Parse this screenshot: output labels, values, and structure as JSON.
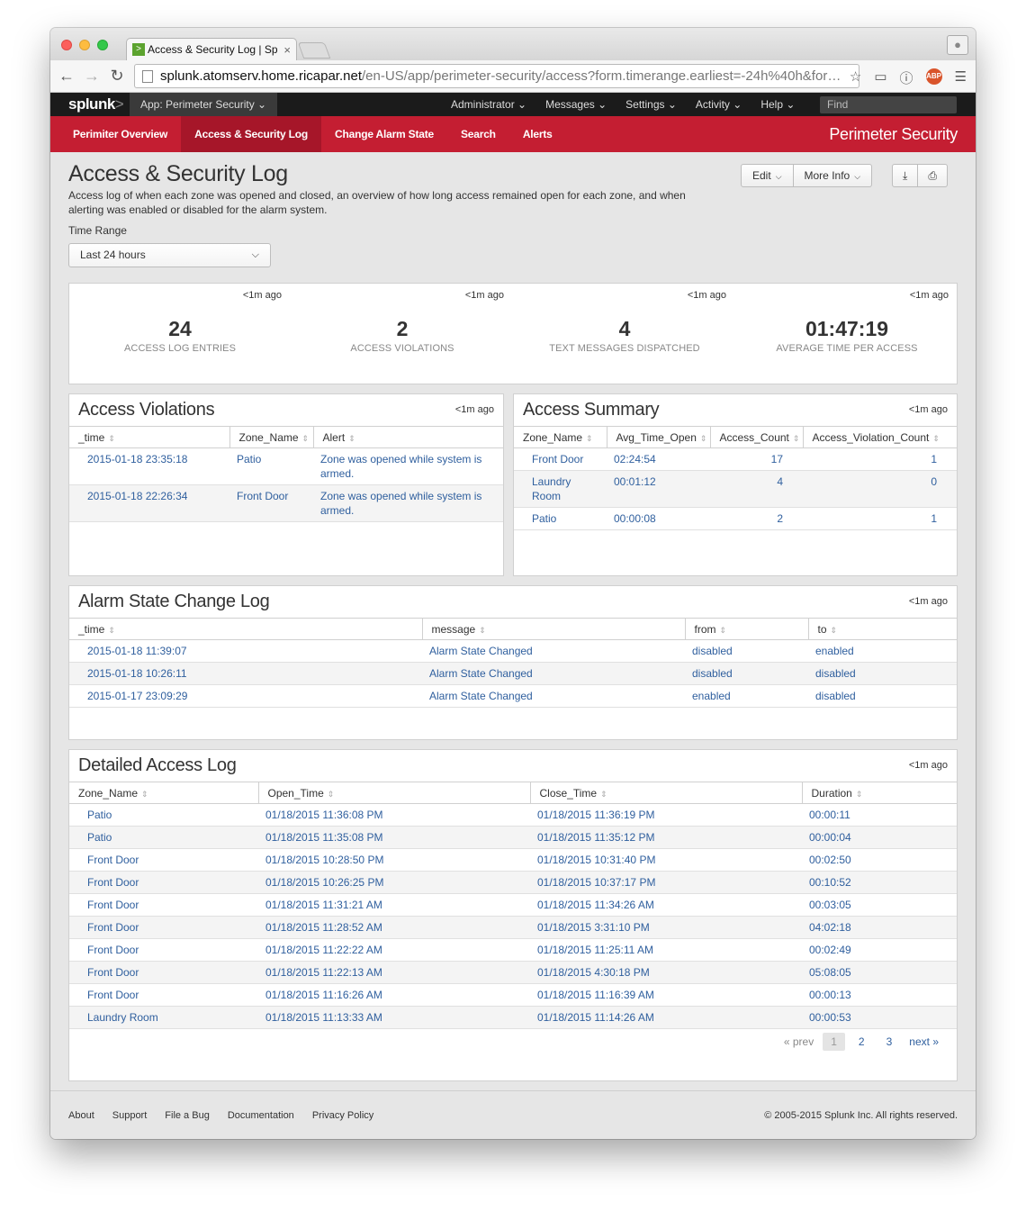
{
  "browser": {
    "tab_title": "Access & Security Log | Sp",
    "tab_close": "×",
    "url_host": "splunk.atomserv.home.ricapar.net",
    "url_path": "/en-US/app/perimeter-security/access?form.timerange.earliest=-24h%40h&for…",
    "back_glyph": "←",
    "forward_glyph": "→",
    "reload_glyph": "↻",
    "abp_label": "ABP"
  },
  "splunkbar": {
    "logo": "splunk",
    "logo_mark": ">",
    "app_menu": "App: Perimeter Security ⌄",
    "menus": [
      "Administrator ⌄",
      "Messages ⌄",
      "Settings ⌄",
      "Activity ⌄",
      "Help ⌄"
    ],
    "find_placeholder": "Find"
  },
  "appnav": {
    "items": [
      "Perimiter Overview",
      "Access & Security Log",
      "Change Alarm State",
      "Search",
      "Alerts"
    ],
    "app_title": "Perimeter Security"
  },
  "page": {
    "title": "Access & Security Log",
    "description": "Access log of when each zone was opened and closed, an overview of how long access remained open for each zone, and when alerting was enabled or disabled for the alarm system.",
    "edit_label": "Edit",
    "more_info_label": "More Info",
    "time_range_label": "Time Range",
    "time_range_value": "Last 24 hours"
  },
  "single_values": [
    {
      "refresh": "<1m ago",
      "value": "24",
      "label": "ACCESS LOG ENTRIES"
    },
    {
      "refresh": "<1m ago",
      "value": "2",
      "label": "ACCESS VIOLATIONS"
    },
    {
      "refresh": "<1m ago",
      "value": "4",
      "label": "TEXT MESSAGES DISPATCHED"
    },
    {
      "refresh": "<1m ago",
      "value": "01:47:19",
      "label": "AVERAGE TIME PER ACCESS"
    }
  ],
  "access_violations": {
    "title": "Access Violations",
    "refresh": "<1m ago",
    "columns": [
      "_time",
      "Zone_Name",
      "Alert"
    ],
    "rows": [
      [
        "2015-01-18 23:35:18",
        "Patio",
        "Zone was opened while system is armed."
      ],
      [
        "2015-01-18 22:26:34",
        "Front Door",
        "Zone was opened while system is armed."
      ]
    ]
  },
  "access_summary": {
    "title": "Access Summary",
    "refresh": "<1m ago",
    "columns": [
      "Zone_Name",
      "Avg_Time_Open",
      "Access_Count",
      "Access_Violation_Count"
    ],
    "rows": [
      [
        "Front Door",
        "02:24:54",
        "17",
        "1"
      ],
      [
        "Laundry Room",
        "00:01:12",
        "4",
        "0"
      ],
      [
        "Patio",
        "00:00:08",
        "2",
        "1"
      ]
    ]
  },
  "alarm_log": {
    "title": "Alarm State Change Log",
    "refresh": "<1m ago",
    "columns": [
      "_time",
      "message",
      "from",
      "to"
    ],
    "rows": [
      [
        "2015-01-18 11:39:07",
        "Alarm State Changed",
        "disabled",
        "enabled"
      ],
      [
        "2015-01-18 10:26:11",
        "Alarm State Changed",
        "disabled",
        "disabled"
      ],
      [
        "2015-01-17 23:09:29",
        "Alarm State Changed",
        "enabled",
        "disabled"
      ]
    ]
  },
  "detailed_log": {
    "title": "Detailed Access Log",
    "refresh": "<1m ago",
    "columns": [
      "Zone_Name",
      "Open_Time",
      "Close_Time",
      "Duration"
    ],
    "rows": [
      [
        "Patio",
        "01/18/2015 11:36:08 PM",
        "01/18/2015 11:36:19 PM",
        "00:00:11"
      ],
      [
        "Patio",
        "01/18/2015 11:35:08 PM",
        "01/18/2015 11:35:12 PM",
        "00:00:04"
      ],
      [
        "Front Door",
        "01/18/2015 10:28:50 PM",
        "01/18/2015 10:31:40 PM",
        "00:02:50"
      ],
      [
        "Front Door",
        "01/18/2015 10:26:25 PM",
        "01/18/2015 10:37:17 PM",
        "00:10:52"
      ],
      [
        "Front Door",
        "01/18/2015 11:31:21 AM",
        "01/18/2015 11:34:26 AM",
        "00:03:05"
      ],
      [
        "Front Door",
        "01/18/2015 11:28:52 AM",
        "01/18/2015 3:31:10 PM",
        "04:02:18"
      ],
      [
        "Front Door",
        "01/18/2015 11:22:22 AM",
        "01/18/2015 11:25:11 AM",
        "00:02:49"
      ],
      [
        "Front Door",
        "01/18/2015 11:22:13 AM",
        "01/18/2015 4:30:18 PM",
        "05:08:05"
      ],
      [
        "Front Door",
        "01/18/2015 11:16:26 AM",
        "01/18/2015 11:16:39 AM",
        "00:00:13"
      ],
      [
        "Laundry Room",
        "01/18/2015 11:13:33 AM",
        "01/18/2015 11:14:26 AM",
        "00:00:53"
      ]
    ],
    "pager": {
      "prev": "« prev",
      "pages": [
        "1",
        "2",
        "3"
      ],
      "next": "next »"
    }
  },
  "footer": {
    "links": [
      "About",
      "Support",
      "File a Bug",
      "Documentation",
      "Privacy Policy"
    ],
    "copyright": "© 2005-2015 Splunk Inc. All rights reserved."
  },
  "colors": {
    "accent": "#c41e32",
    "link": "#2f5f9e",
    "splunkbar": "#1b1b1b"
  }
}
